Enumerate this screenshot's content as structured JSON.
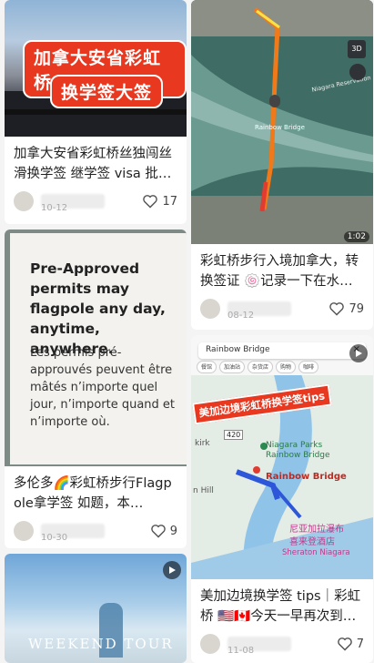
{
  "colors": {
    "accent_red": "#e8381f",
    "background": "#f4f4f4",
    "card": "#ffffff"
  },
  "left_column": {
    "cards": [
      {
        "cover_lines": [
          "加拿大安省彩虹桥",
          "换学签大签"
        ],
        "title": "加拿大安省彩虹桥丝独闯丝滑换学签 继学签 visa 批准…",
        "date": "10-12",
        "likes": "17"
      },
      {
        "sign_heading": "Pre-Approved permits may flagpole any day, anytime, anywhere.",
        "sign_body": "Les permis pré-approuvés peuvent être mâtés n’importe quel jour, n’importe quand et n’importe où.",
        "title": "多伦多🌈彩虹桥步行Flagpole拿学签 如题，本…",
        "date": "10-30",
        "likes": "9"
      },
      {
        "cover_text": "WEEKEND TOUR",
        "has_video": true
      }
    ]
  },
  "right_column": {
    "cards": [
      {
        "map_labels": [
          "Rainbow Bridge",
          "Niagara Reservation"
        ],
        "map_button_3d": "3D",
        "duration": "1:02",
        "title": "彩虹桥步行入境加拿大，转换签证 🍥记录一下在水牛…",
        "date": "08-12",
        "likes": "79"
      },
      {
        "search_text": "Rainbow Bridge",
        "tabs": [
          "餐馆",
          "加油站",
          "杂货店",
          "购物",
          "咖啡"
        ],
        "banner": "美加边境彩虹桥换学签tips",
        "map_labels": {
          "park": "Niagara Parks Rainbow Bridge",
          "bridge": "Rainbow Bridge",
          "route": "420",
          "park_cn": "尼亚加拉瀑布",
          "park_cn_2": "喜来登酒店",
          "hotel": "Sheraton Niagara",
          "kirk": "kirk",
          "hill": "n Hill"
        },
        "title": "美加边境换学签 tips｜彩虹桥 🇺🇸🇨🇦今天一早再次到…",
        "date": "11-08",
        "likes": "7"
      }
    ]
  }
}
